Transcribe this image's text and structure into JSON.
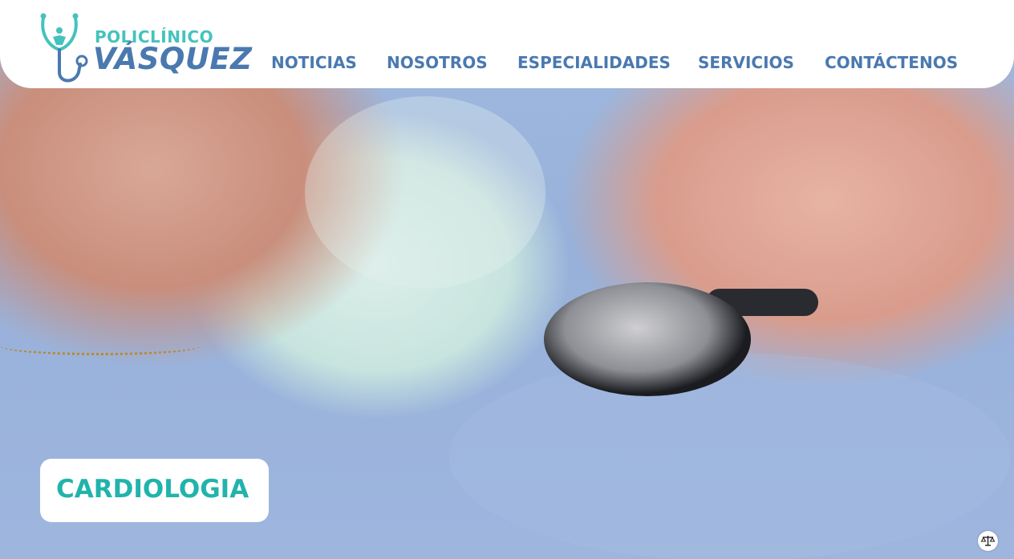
{
  "brand": {
    "line1": "POLICLÍNICO",
    "line2": "VÁSQUEZ",
    "colors": {
      "teal": "#45c2bd",
      "blue": "#4a79b0"
    }
  },
  "nav": [
    {
      "label": "NOTICIAS"
    },
    {
      "label": "NOSOTROS"
    },
    {
      "label": "ESPECIALIDADES"
    },
    {
      "label": "SERVICIOS"
    },
    {
      "label": "CONTÁCTENOS"
    }
  ],
  "hero": {
    "title": "CARDIOLOGIA",
    "image": "elderly-patient-stethoscope-photo"
  },
  "accessibility": {
    "icon": "scale-icon"
  }
}
